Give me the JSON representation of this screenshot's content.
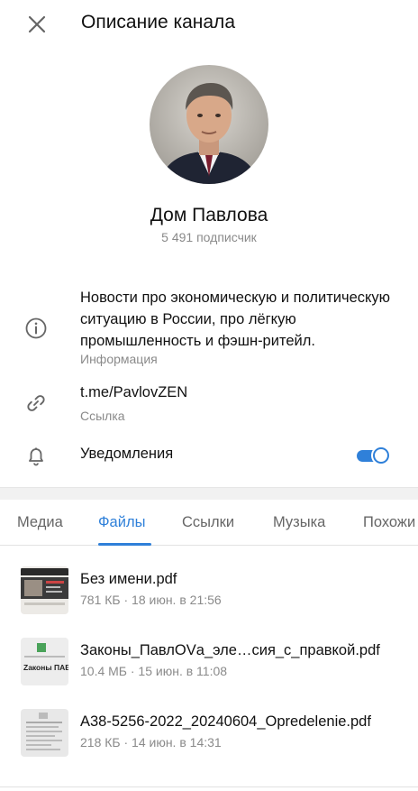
{
  "header": {
    "title": "Описание канала",
    "close_icon": "close-icon"
  },
  "channel": {
    "name": "Дом Павлова",
    "subscribers": "5 491 подписчик",
    "avatar_icon": "channel-avatar"
  },
  "info": {
    "description": "Новости про экономическую и политическую ситуацию в России, про лёгкую промышленность и фэшн-ритейл.",
    "description_label": "Информация",
    "link": "t.me/PavlovZEN",
    "link_label": "Ссылка",
    "notifications_label": "Уведомления",
    "notifications_on": true
  },
  "tabs": [
    {
      "label": "Медиа",
      "active": false
    },
    {
      "label": "Файлы",
      "active": true
    },
    {
      "label": "Ссылки",
      "active": false
    },
    {
      "label": "Музыка",
      "active": false
    },
    {
      "label": "Похожи",
      "active": false
    }
  ],
  "files": [
    {
      "name": "Без имени.pdf",
      "meta": "781 КБ · 18 июн. в 21:56"
    },
    {
      "name": "Законы_ПавлOVа_эле…сия_с_правкой.pdf",
      "meta": "10.4 МБ · 15 июн. в 11:08",
      "thumb_text": "Zаконы ПАВЛOVа"
    },
    {
      "name": "А38-5256-2022_20240604_Opredelenie.pdf",
      "meta": "218 КБ · 14 июн. в 14:31"
    }
  ],
  "colors": {
    "accent": "#2f80d9",
    "secondary_text": "#8a8a8a"
  }
}
